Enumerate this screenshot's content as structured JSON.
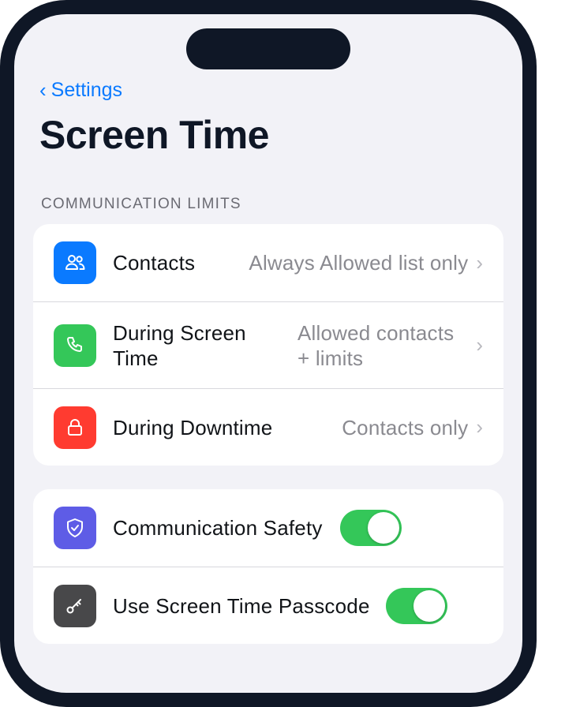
{
  "nav": {
    "back_label": "Settings"
  },
  "page": {
    "title": "Screen Time"
  },
  "section": {
    "header": "COMMUNICATION LIMITS"
  },
  "limits": [
    {
      "label": "Contacts",
      "value": "Always Allowed list only",
      "icon": "person-2-icon",
      "icon_color": "#0a7aff"
    },
    {
      "label_line1": "During Screen",
      "label_line2": "Time",
      "value_line1": "Allowed contacts",
      "value_line2": "+ limits",
      "icon": "phone-icon",
      "icon_color": "#34c759"
    },
    {
      "label": "During Downtime",
      "value": "Contacts only",
      "icon": "lock-icon",
      "icon_color": "#ff3b30"
    }
  ],
  "toggles": [
    {
      "label": "Communication Safety",
      "state": "on",
      "icon": "shield-check-icon",
      "icon_color": "#5e5ce6"
    },
    {
      "label": "Use Screen Time Passcode",
      "state": "on",
      "icon": "key-icon",
      "icon_color": "#48484a"
    }
  ],
  "colors": {
    "accent": "#0a7aff",
    "toggle_on": "#34c759",
    "frame": "#0f1726",
    "background": "#f2f2f7"
  }
}
